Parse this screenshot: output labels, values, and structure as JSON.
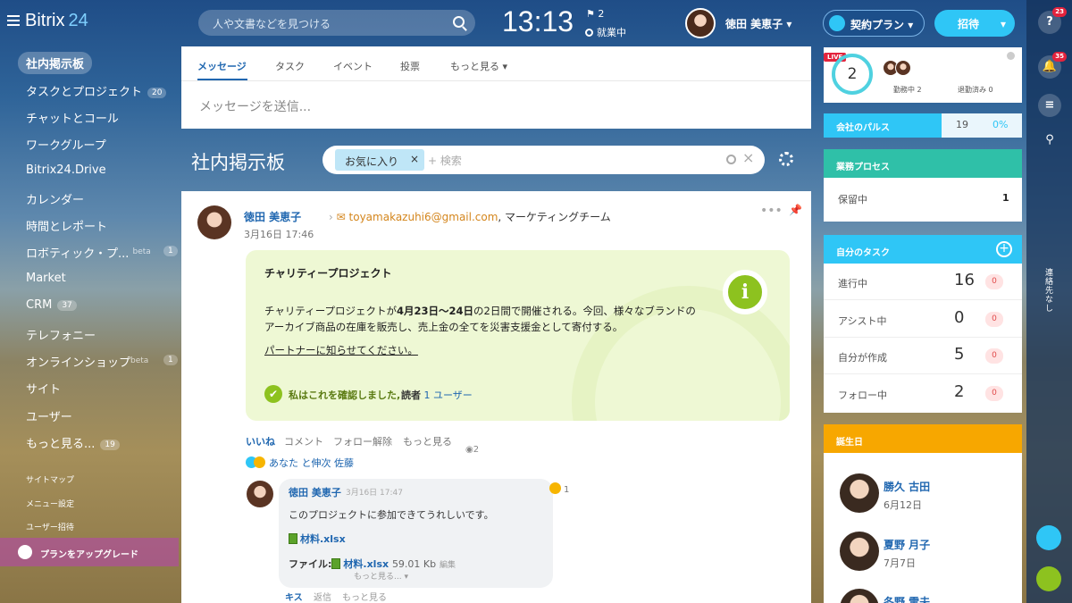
{
  "header": {
    "logo": "Bitrix",
    "logo_num": "24",
    "search_placeholder": "人や文書などを見つける",
    "clock": "13:13",
    "flag_count": "2",
    "work_status": "就業中",
    "user_name": "徳田 美恵子",
    "plan_label": "契約プラン",
    "invite_label": "招待"
  },
  "sidebar": {
    "active": "社内掲示板",
    "items": [
      {
        "label": "タスクとプロジェクト",
        "badge": "20"
      },
      {
        "label": "チャットとコール",
        "badge": ""
      },
      {
        "label": "ワークグループ",
        "badge": ""
      },
      {
        "label": "Bitrix24.Drive",
        "badge": ""
      },
      {
        "label": "カレンダー",
        "badge": ""
      },
      {
        "label": "時間とレポート",
        "badge": ""
      },
      {
        "label": "ロボティック・プ...",
        "badge": "1",
        "tag": "beta"
      },
      {
        "label": "Market",
        "badge": ""
      },
      {
        "label": "CRM",
        "badge": "37"
      },
      {
        "label": "テレフォニー",
        "badge": ""
      },
      {
        "label": "オンラインショップ",
        "badge": "1",
        "tag": "beta"
      },
      {
        "label": "サイト",
        "badge": ""
      },
      {
        "label": "ユーザー",
        "badge": ""
      },
      {
        "label": "もっと見る...",
        "badge": "19"
      }
    ],
    "small": [
      "サイトマップ",
      "メニュー設定",
      "ユーザー招待"
    ],
    "upgrade": "プランをアップグレード"
  },
  "compose": {
    "tabs": [
      "メッセージ",
      "タスク",
      "イベント",
      "投票",
      "もっと見る"
    ],
    "placeholder": "メッセージを送信..."
  },
  "feed": {
    "title": "社内掲示板",
    "filter_tag": "お気に入り",
    "filter_placeholder": "+ 検索"
  },
  "post": {
    "author": "徳田 美恵子",
    "email": "toyamakazuhi6@gmail.com",
    "team": ", マーケティングチーム",
    "date": "3月16日 17:46",
    "info_title": "チャリティープロジェクト",
    "info_body_pre": "チャリティープロジェクトが",
    "info_body_bold": "4月23日〜24日",
    "info_body_post": "の2日間で開催される。今回、様々なブランドのアーカイブ商品の在庫を販売し、売上金の全てを災害支援金として寄付する。",
    "info_link": "パートナーに知らせてください。",
    "info_icon": "i",
    "confirm_text": "私はこれを確認しました,",
    "confirm_readers_label": "読者",
    "confirm_readers": "1 ユーザー",
    "actions": [
      "いいね",
      "コメント",
      "フォロー解除",
      "もっと見る"
    ],
    "views": "2",
    "likers": "あなた と伸次 佐藤"
  },
  "comment": {
    "author": "徳田 美恵子",
    "date": "3月16日 17:47",
    "text": "このプロジェクトに参加できてうれしいです。",
    "file1": "材料.xlsx",
    "file_label": "ファイル:",
    "file2": "材料.xlsx",
    "file2_size": "59.01 Kb",
    "file2_edit": "編集",
    "more": "もっと見る...",
    "reaction_count": "1",
    "actions": [
      "キス",
      "返信",
      "もっと見る"
    ]
  },
  "right": {
    "live_badge": "LIVE",
    "live_count": "2",
    "live_working": "勤務中 2",
    "live_off": "退勤済み 0",
    "pulse_label": "会社のパルス",
    "pulse_num": "19",
    "pulse_pct": "0%",
    "process_title": "業務プロセス",
    "process_label": "保留中",
    "process_val": "1",
    "tasks_title": "自分のタスク",
    "tasks": [
      {
        "label": "進行中",
        "count": "16",
        "counter": "0"
      },
      {
        "label": "アシスト中",
        "count": "0",
        "counter": "0"
      },
      {
        "label": "自分が作成",
        "count": "5",
        "counter": "0"
      },
      {
        "label": "フォロー中",
        "count": "2",
        "counter": "0"
      }
    ],
    "bday_title": "誕生日",
    "bdays": [
      {
        "name": "勝久 古田",
        "date": "6月12日"
      },
      {
        "name": "夏野 月子",
        "date": "7月7日"
      },
      {
        "name": "冬野 雪夫",
        "date": ""
      }
    ]
  },
  "rbar": {
    "help_badge": "23",
    "notif_badge": "35",
    "vertical": "連絡先なし"
  },
  "colors": {
    "accent": "#2fc6f6",
    "green": "#8dc21f",
    "teal": "#2fc0a8",
    "orange": "#f7a700",
    "live": "#e3233d"
  }
}
